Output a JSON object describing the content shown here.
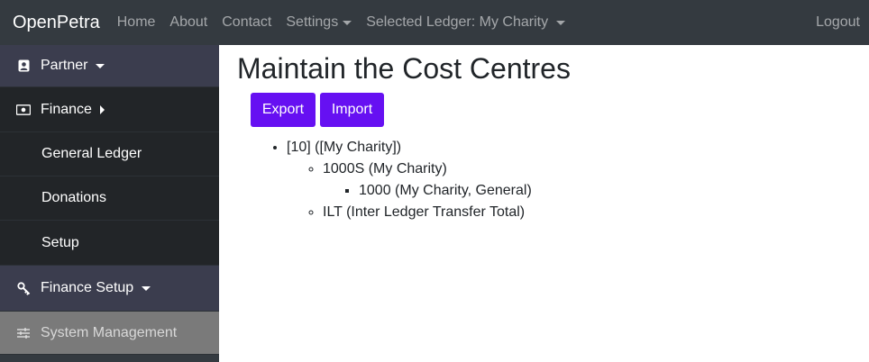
{
  "topnav": {
    "brand": "OpenPetra",
    "home": "Home",
    "about": "About",
    "contact": "Contact",
    "settings": "Settings",
    "ledger": "Selected Ledger: My Charity",
    "logout": "Logout"
  },
  "sidebar": {
    "partner": "Partner",
    "finance": "Finance",
    "general_ledger": "General Ledger",
    "donations": "Donations",
    "setup": "Setup",
    "finance_setup": "Finance Setup",
    "system_management": "System Management"
  },
  "main": {
    "title": "Maintain the Cost Centres",
    "export_label": "Export",
    "import_label": "Import",
    "tree": {
      "root": "[10] ([My Charity])",
      "child1": "1000S (My Charity)",
      "grandchild1": "1000 (My Charity, General)",
      "child2": "ILT (Inter Ledger Transfer Total)"
    }
  },
  "colors": {
    "navbar": "#343a40",
    "accent_button": "#6610f2",
    "sidebar_active": "#7a7a7a"
  }
}
